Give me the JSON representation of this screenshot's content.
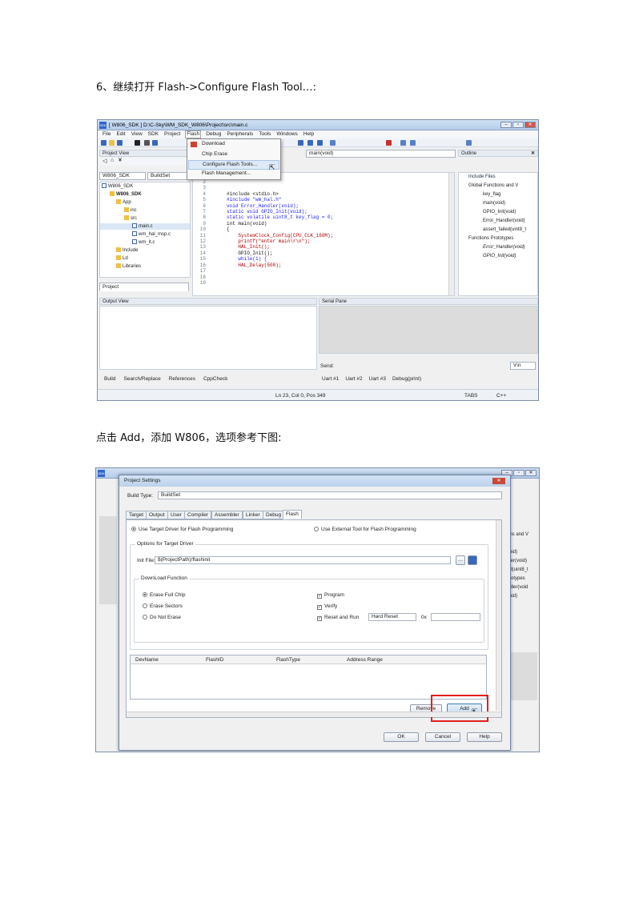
{
  "doc": {
    "heading1": "6、继续打开 Flash->Configure Flash Tool…:",
    "heading2": "点击 Add，添加 W806，选项参考下图:"
  },
  "shot1": {
    "title": "[ W806_SDK ] D:\\C-Sky\\WM_SDK_W806\\Project\\src\\main.c",
    "menu": [
      "File",
      "Edit",
      "View",
      "SDK",
      "Project",
      "Flash",
      "Debug",
      "Peripherals",
      "Tools",
      "Windows",
      "Help"
    ],
    "flash_menu": [
      "Download",
      "Chip Erase",
      "Configure Flash Tools...",
      "Flash Management..."
    ],
    "project_view_title": "Project View",
    "project_combo": "W806_SDK",
    "build_combo": "BuildSet",
    "func_combo": "main(void)",
    "tree": [
      "W806_SDK",
      "W806_SDK",
      "App",
      "inc",
      "src",
      "main.c",
      "wm_hal_msp.c",
      "wm_it.c",
      "Include",
      "Ld",
      "Libraries"
    ],
    "project_tab": "Project",
    "line_numbers": [
      "2",
      "3",
      "4",
      "5",
      "6",
      "7",
      "8",
      "9",
      "10",
      "11",
      "12",
      "13",
      "14",
      "15",
      "16",
      "17",
      "18",
      "19"
    ],
    "code_lines": [
      "#include <stdio.h>",
      "#include \"wm_hal.h\"",
      "",
      "void Error_Handler(void);",
      "static void GPIO_Init(void);",
      "",
      "static volatile uint8_t key_flag = 0;",
      "",
      "int main(void)",
      "{",
      "    SystemClock_Config(CPU_CLK_160M);",
      "    printf(\"enter main\\r\\n\");",
      "    HAL_Init();",
      "    GPIO_Init();",
      "",
      "    while(1) {",
      "",
      "    HAL_Delay(500);"
    ],
    "outline_title": "Outline",
    "outline": [
      "Include Files",
      "Global Functions and V",
      "key_flag",
      "main(void)",
      "GPIO_Init(void)",
      "Error_Handler(void)",
      "assert_failed(uint8_t",
      "Functions Prototypes",
      "Error_Handler(void)",
      "GPIO_Init(void)"
    ],
    "output_title": "Output View",
    "serial_title": "Serial Pane",
    "send_label": "Send:",
    "eol_value": "\\r\\n",
    "bottom_tabs": [
      "Build",
      "Search/Replace",
      "References",
      "CppCheck"
    ],
    "uart_tabs": [
      "Uart #1",
      "Uart #2",
      "Uart #3",
      "Debug(print)"
    ],
    "status_pos": "Ln 23, Col 0, Pos 349",
    "status_tabs": "TABS",
    "status_lang": "C++"
  },
  "shot2": {
    "dialog_title": "Project Settings",
    "build_type_label": "Build Type:",
    "build_type_value": "BuildSet",
    "tabs": [
      "Target",
      "Output",
      "User",
      "Compiler",
      "Assembler",
      "Linker",
      "Debug",
      "Flash"
    ],
    "radio_target": "Use Target Driver for Flash Programming",
    "radio_external": "Use External Tool for Flash Programming",
    "options_group": "Options for Target Driver",
    "init_file_label": "Init File:",
    "init_file_value": "$(ProjectPath)/flashinit",
    "download_group": "DownLoad Function",
    "erase_options": [
      "Erase Full Chip",
      "Erase Sectors",
      "Do Not Erase"
    ],
    "checks": [
      "Program",
      "Verify",
      "Reset and Run"
    ],
    "reset_value": "Hard Reset",
    "ox_label": "0x",
    "table_cols": [
      "DevName",
      "FlashID",
      "FlashType",
      "Address Range"
    ],
    "remove_label": "Remove",
    "add_label": "Add",
    "ok_label": "OK",
    "cancel_label": "Cancel",
    "help_label": "Help",
    "behind_fragments": [
      "ons and V",
      ")",
      "void)",
      "dler(void)",
      "ed(uint8_t",
      "ototypes",
      "ndler(void",
      "void)"
    ],
    "highlight_color": "#e02020"
  }
}
